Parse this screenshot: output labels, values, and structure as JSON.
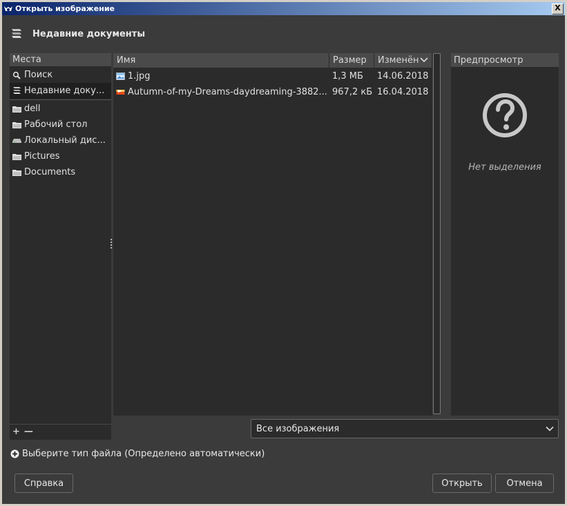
{
  "window": {
    "title": "Открыть изображение",
    "close_label": "X"
  },
  "location": {
    "title": "Недавние документы"
  },
  "places": {
    "header": "Места",
    "items_top": [
      {
        "label": "Поиск",
        "icon": "search-icon"
      },
      {
        "label": "Недавние доку...",
        "icon": "recent-icon",
        "selected": true
      }
    ],
    "items_bottom": [
      {
        "label": "dell",
        "icon": "folder-home-icon"
      },
      {
        "label": "Рабочий стол",
        "icon": "folder-icon"
      },
      {
        "label": "Локальный дис...",
        "icon": "drive-icon"
      },
      {
        "label": "Pictures",
        "icon": "folder-icon"
      },
      {
        "label": "Documents",
        "icon": "folder-icon"
      }
    ],
    "add_label": "+",
    "remove_label": "—"
  },
  "filelist": {
    "columns": {
      "name": "Имя",
      "size": "Размер",
      "modified": "Изменён"
    },
    "rows": [
      {
        "name": "1.jpg",
        "size": "1,3 МБ",
        "modified": "14.06.2018",
        "icon": "image-file-icon"
      },
      {
        "name": "Autumn-of-my-Dreams-daydreaming-3882...",
        "size": "967,2 кБ",
        "modified": "16.04.2018",
        "icon": "image-file-icon"
      }
    ]
  },
  "preview": {
    "header": "Предпросмотр",
    "empty_text": "Нет выделения"
  },
  "filter": {
    "selected": "Все изображения"
  },
  "expander": {
    "label": "Выберите тип файла (Определено автоматически)"
  },
  "buttons": {
    "help": "Справка",
    "open": "Открыть",
    "cancel": "Отмена"
  },
  "colors": {
    "background": "#3b3b3b",
    "pane": "#2b2b2b",
    "header": "#4a4a4a",
    "titlebar_start": "#0a246a",
    "titlebar_end": "#a6caf0"
  }
}
